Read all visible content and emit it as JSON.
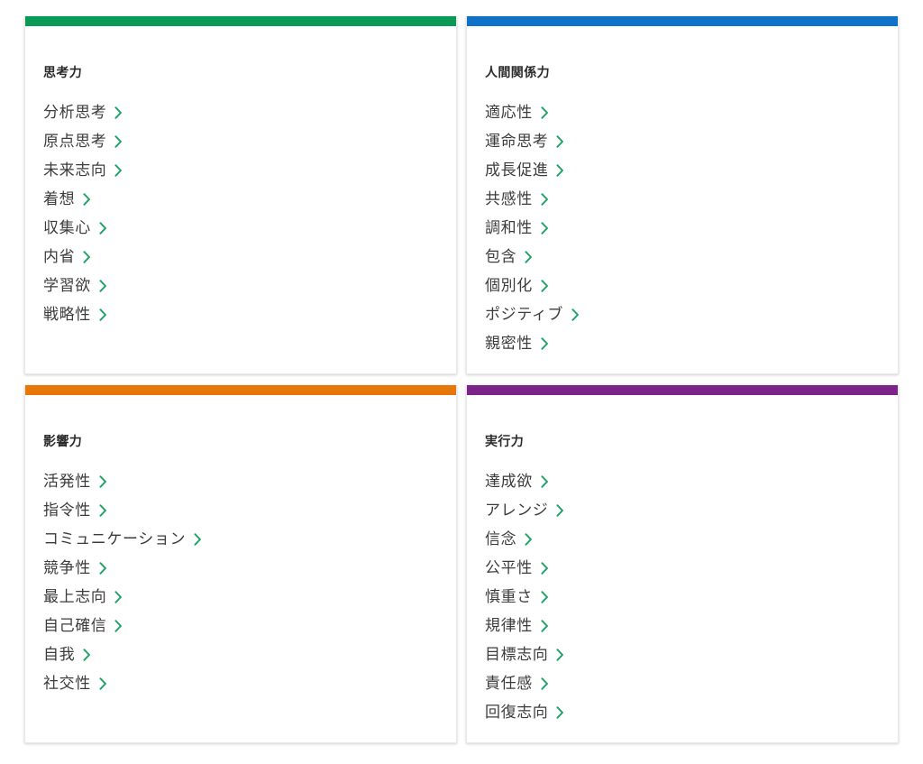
{
  "page": {
    "background_color": "#ffffff",
    "chevron_color": "#1aa362",
    "title_color": "#2b2b2b",
    "item_color": "#3c3c3c"
  },
  "cards": [
    {
      "id": "thinking",
      "title": "思考力",
      "accent_color": "#0a9a56",
      "chevron_icon": "chevron-right-icon",
      "items": [
        {
          "label": "分析思考"
        },
        {
          "label": "原点思考"
        },
        {
          "label": "未来志向"
        },
        {
          "label": "着想"
        },
        {
          "label": "収集心"
        },
        {
          "label": "内省"
        },
        {
          "label": "学習欲"
        },
        {
          "label": "戦略性"
        }
      ]
    },
    {
      "id": "relationship",
      "title": "人間関係力",
      "accent_color": "#0f72c8",
      "chevron_icon": "chevron-right-icon",
      "items": [
        {
          "label": "適応性"
        },
        {
          "label": "運命思考"
        },
        {
          "label": "成長促進"
        },
        {
          "label": "共感性"
        },
        {
          "label": "調和性"
        },
        {
          "label": "包含"
        },
        {
          "label": "個別化"
        },
        {
          "label": "ポジティブ"
        },
        {
          "label": "親密性"
        }
      ]
    },
    {
      "id": "influence",
      "title": "影響力",
      "accent_color": "#e87709",
      "chevron_icon": "chevron-right-icon",
      "items": [
        {
          "label": "活発性"
        },
        {
          "label": "指令性"
        },
        {
          "label": "コミュニケーション"
        },
        {
          "label": "競争性"
        },
        {
          "label": "最上志向"
        },
        {
          "label": "自己確信"
        },
        {
          "label": "自我"
        },
        {
          "label": "社交性"
        }
      ]
    },
    {
      "id": "execution",
      "title": "実行力",
      "accent_color": "#7c2489",
      "chevron_icon": "chevron-right-icon",
      "items": [
        {
          "label": "達成欲"
        },
        {
          "label": "アレンジ"
        },
        {
          "label": "信念"
        },
        {
          "label": "公平性"
        },
        {
          "label": "慎重さ"
        },
        {
          "label": "規律性"
        },
        {
          "label": "目標志向"
        },
        {
          "label": "責任感"
        },
        {
          "label": "回復志向"
        }
      ]
    }
  ]
}
